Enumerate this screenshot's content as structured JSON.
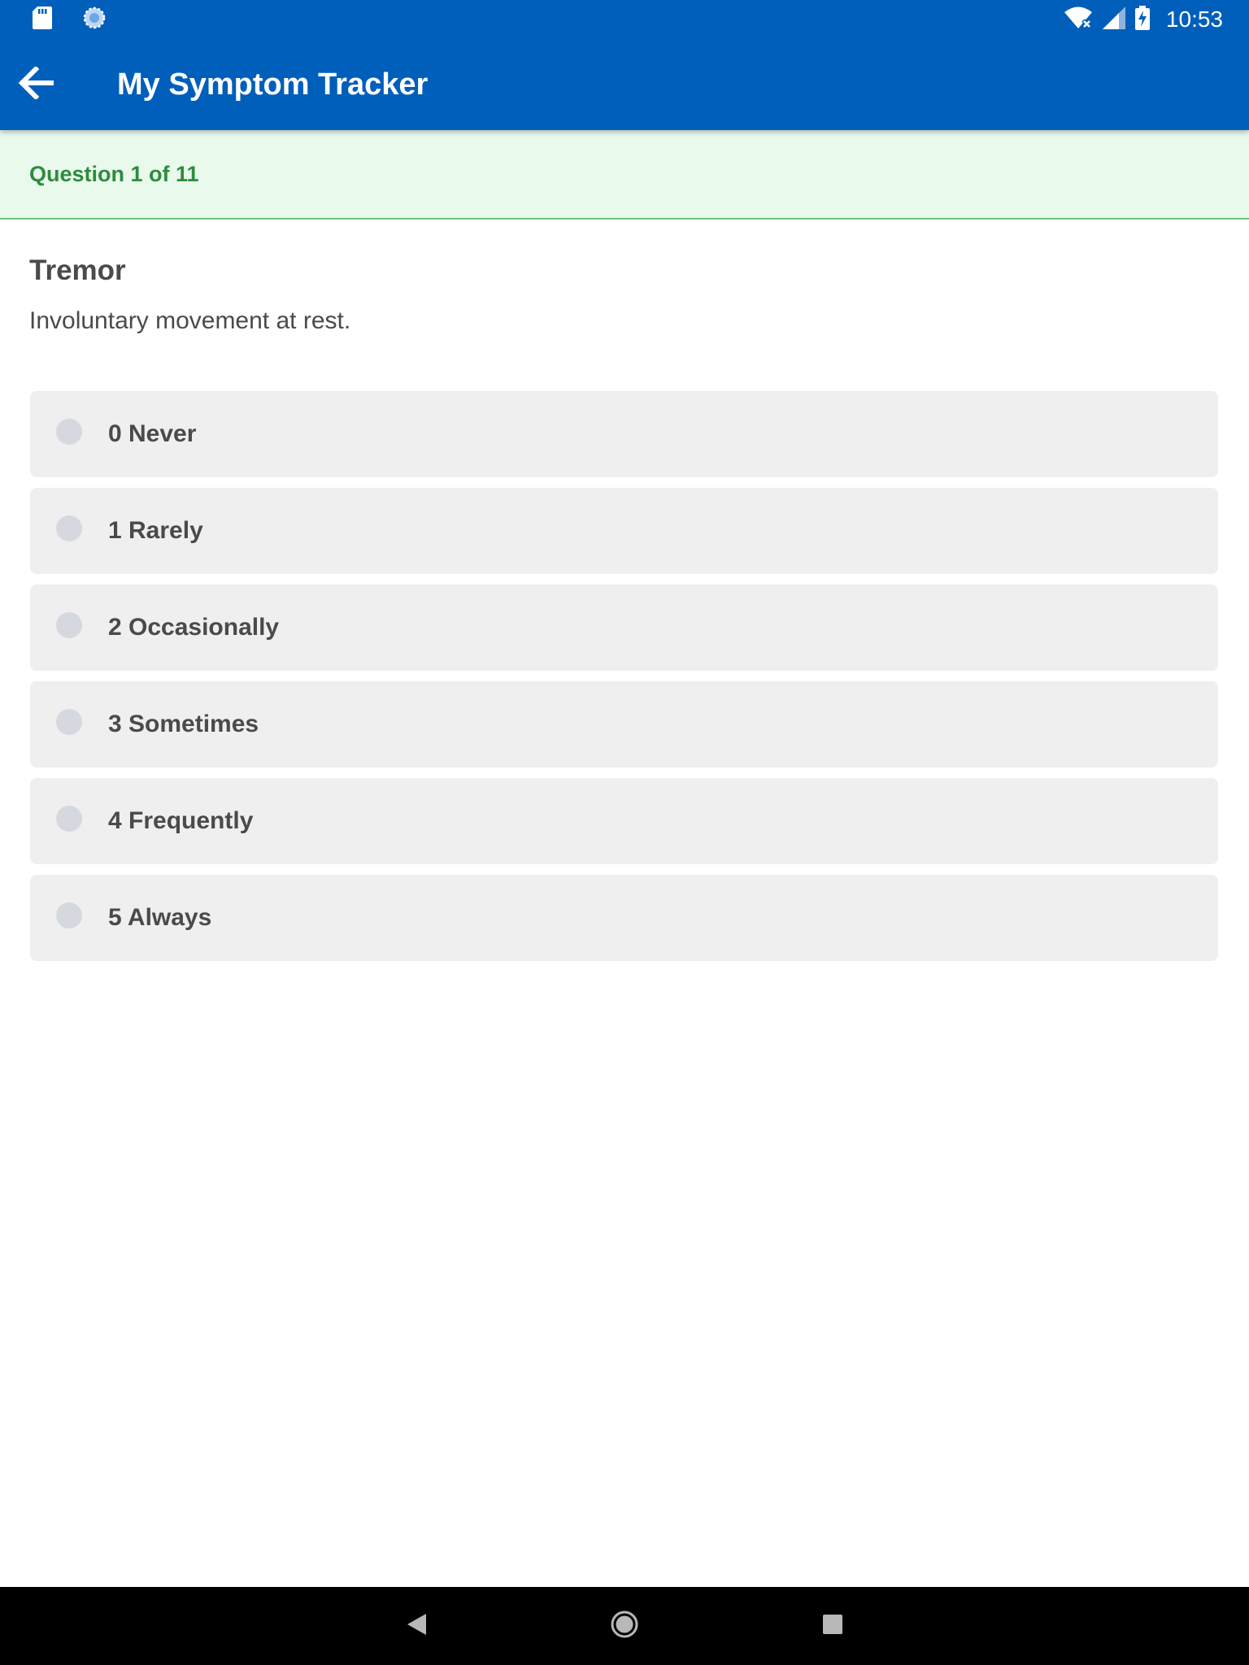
{
  "status_bar": {
    "time": "10:53",
    "left_icons": [
      "sd-card-icon",
      "sync-icon"
    ],
    "right_icons": [
      "wifi-icon",
      "signal-icon",
      "battery-charging-icon"
    ]
  },
  "app_bar": {
    "title": "My Symptom Tracker",
    "back_icon": "arrow-back-icon"
  },
  "progress": {
    "text": "Question 1 of 11"
  },
  "question": {
    "title": "Tremor",
    "description": "Involuntary movement at rest."
  },
  "options": [
    {
      "label": "0 Never",
      "selected": false
    },
    {
      "label": "1 Rarely",
      "selected": false
    },
    {
      "label": "2 Occasionally",
      "selected": false
    },
    {
      "label": "3 Sometimes",
      "selected": false
    },
    {
      "label": "4 Frequently",
      "selected": false
    },
    {
      "label": "5 Always",
      "selected": false
    }
  ],
  "nav_bar": {
    "icons": [
      "back-triangle-icon",
      "home-circle-icon",
      "recents-square-icon"
    ]
  },
  "colors": {
    "primary": "#005fbb",
    "progress_background": "#e9f9ec",
    "progress_text": "#2e8b3e",
    "option_background": "#efefef",
    "radio_unselected": "#d5d8de",
    "text_dark": "#4a4a4a"
  }
}
